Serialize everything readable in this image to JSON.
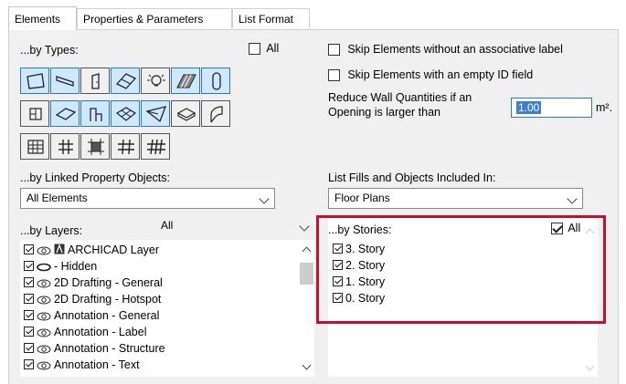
{
  "tabs": [
    {
      "label": "Elements",
      "active": true
    },
    {
      "label": "Properties & Parameters",
      "active": false
    },
    {
      "label": "List Format",
      "active": false
    }
  ],
  "types": {
    "label": "...by Types:",
    "all_label": "All",
    "all_checked": false,
    "buttons": [
      {
        "icon": "wall-icon",
        "selected": true
      },
      {
        "icon": "column-icon",
        "selected": true
      },
      {
        "icon": "door-icon",
        "selected": false
      },
      {
        "icon": "window-icon",
        "selected": true
      },
      {
        "icon": "lamp-icon",
        "selected": false
      },
      {
        "icon": "roof-icon",
        "selected": true
      },
      {
        "icon": "beam-icon",
        "selected": true
      },
      {
        "icon": "stair-icon",
        "selected": false
      },
      {
        "icon": "slab-icon",
        "selected": true
      },
      {
        "icon": "object-icon",
        "selected": true
      },
      {
        "icon": "mesh-icon",
        "selected": true
      },
      {
        "icon": "morph-icon",
        "selected": true
      },
      {
        "icon": "shell-icon",
        "selected": false
      },
      {
        "icon": "skylight-icon",
        "selected": false
      },
      {
        "icon": "curtain-wall-icon",
        "selected": false
      },
      {
        "icon": "railing-icon",
        "selected": false
      },
      {
        "icon": "panel-icon",
        "selected": false
      },
      {
        "icon": "frame-icon",
        "selected": false
      },
      {
        "icon": "accessory-icon",
        "selected": false
      }
    ]
  },
  "options": {
    "skip_assoc_label": "Skip Elements without an associative label",
    "skip_empty_id": "Skip Elements with an empty ID field",
    "reduce_label_1": "Reduce Wall Quantities if an",
    "reduce_label_2": "Opening is larger than",
    "reduce_value": "1.00",
    "reduce_unit": "m²."
  },
  "linked": {
    "label": "...by Linked Property Objects:",
    "value": "All Elements"
  },
  "fills": {
    "label": "List Fills and Objects Included In:",
    "value": "Floor Plans"
  },
  "layers": {
    "label": "...by Layers:",
    "filter": "All",
    "items": [
      {
        "name": "ARCHICAD Layer",
        "hidden": false,
        "special": true
      },
      {
        "name": "- Hidden",
        "hidden": true,
        "special": false
      },
      {
        "name": "2D Drafting - General",
        "hidden": false,
        "special": false
      },
      {
        "name": "2D Drafting - Hotspot",
        "hidden": false,
        "special": false
      },
      {
        "name": "Annotation - General",
        "hidden": false,
        "special": false
      },
      {
        "name": "Annotation - Label",
        "hidden": false,
        "special": false
      },
      {
        "name": "Annotation - Structure",
        "hidden": false,
        "special": false
      },
      {
        "name": "Annotation - Text",
        "hidden": false,
        "special": false
      }
    ]
  },
  "stories": {
    "label": "...by Stories:",
    "all_label": "All",
    "all_checked": true,
    "items": [
      "3. Story",
      "2. Story",
      "1. Story",
      "0. Story"
    ]
  }
}
